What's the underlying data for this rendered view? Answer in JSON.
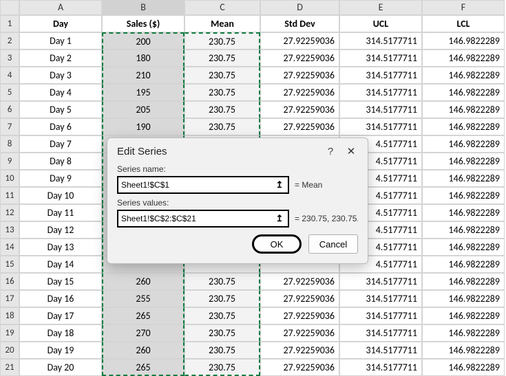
{
  "columns": [
    "A",
    "B",
    "C",
    "D",
    "E",
    "F"
  ],
  "headers": {
    "A": "Day",
    "B": "Sales ($)",
    "C": "Mean",
    "D": "Std Dev",
    "E": "UCL",
    "F": "LCL"
  },
  "rows": [
    {
      "n": 2,
      "day": "Day 1",
      "sales": "200",
      "mean": "230.75",
      "std": "27.92259036",
      "ucl": "314.5177711",
      "lcl": "146.9822289"
    },
    {
      "n": 3,
      "day": "Day 2",
      "sales": "180",
      "mean": "230.75",
      "std": "27.92259036",
      "ucl": "314.5177711",
      "lcl": "146.9822289"
    },
    {
      "n": 4,
      "day": "Day 3",
      "sales": "210",
      "mean": "230.75",
      "std": "27.92259036",
      "ucl": "314.5177711",
      "lcl": "146.9822289"
    },
    {
      "n": 5,
      "day": "Day 4",
      "sales": "195",
      "mean": "230.75",
      "std": "27.92259036",
      "ucl": "314.5177711",
      "lcl": "146.9822289"
    },
    {
      "n": 6,
      "day": "Day 5",
      "sales": "205",
      "mean": "230.75",
      "std": "27.92259036",
      "ucl": "314.5177711",
      "lcl": "146.9822289"
    },
    {
      "n": 7,
      "day": "Day 6",
      "sales": "190",
      "mean": "230.75",
      "std": "27.92259036",
      "ucl": "314.5177711",
      "lcl": "146.9822289"
    },
    {
      "n": 8,
      "day": "Day 7",
      "sales": "",
      "mean": "",
      "std": "",
      "ucl": "4.5177711",
      "lcl": "146.9822289"
    },
    {
      "n": 9,
      "day": "Day 8",
      "sales": "",
      "mean": "",
      "std": "",
      "ucl": "4.5177711",
      "lcl": "146.9822289"
    },
    {
      "n": 10,
      "day": "Day 9",
      "sales": "",
      "mean": "",
      "std": "",
      "ucl": "4.5177711",
      "lcl": "146.9822289"
    },
    {
      "n": 11,
      "day": "Day 10",
      "sales": "",
      "mean": "",
      "std": "",
      "ucl": "4.5177711",
      "lcl": "146.9822289"
    },
    {
      "n": 12,
      "day": "Day 11",
      "sales": "",
      "mean": "",
      "std": "",
      "ucl": "4.5177711",
      "lcl": "146.9822289"
    },
    {
      "n": 13,
      "day": "Day 12",
      "sales": "",
      "mean": "",
      "std": "",
      "ucl": "4.5177711",
      "lcl": "146.9822289"
    },
    {
      "n": 14,
      "day": "Day 13",
      "sales": "",
      "mean": "",
      "std": "",
      "ucl": "4.5177711",
      "lcl": "146.9822289"
    },
    {
      "n": 15,
      "day": "Day 14",
      "sales": "",
      "mean": "",
      "std": "",
      "ucl": "4.5177711",
      "lcl": "146.9822289"
    },
    {
      "n": 16,
      "day": "Day 15",
      "sales": "260",
      "mean": "230.75",
      "std": "27.92259036",
      "ucl": "314.5177711",
      "lcl": "146.9822289"
    },
    {
      "n": 17,
      "day": "Day 16",
      "sales": "255",
      "mean": "230.75",
      "std": "27.92259036",
      "ucl": "314.5177711",
      "lcl": "146.9822289"
    },
    {
      "n": 18,
      "day": "Day 17",
      "sales": "265",
      "mean": "230.75",
      "std": "27.92259036",
      "ucl": "314.5177711",
      "lcl": "146.9822289"
    },
    {
      "n": 19,
      "day": "Day 18",
      "sales": "270",
      "mean": "230.75",
      "std": "27.92259036",
      "ucl": "314.5177711",
      "lcl": "146.9822289"
    },
    {
      "n": 20,
      "day": "Day 19",
      "sales": "260",
      "mean": "230.75",
      "std": "27.92259036",
      "ucl": "314.5177711",
      "lcl": "146.9822289"
    },
    {
      "n": 21,
      "day": "Day 20",
      "sales": "265",
      "mean": "230.75",
      "std": "27.92259036",
      "ucl": "314.5177711",
      "lcl": "146.9822289"
    }
  ],
  "dialog": {
    "title": "Edit Series",
    "help": "?",
    "close": "✕",
    "label_name": "Series name:",
    "input_name": "Sheet1!$C$1",
    "eq_name": "= Mean",
    "label_values": "Series values:",
    "input_values": "Sheet1!$C$2:$C$21",
    "eq_values": "= 230.75, 230.75...",
    "ok": "OK",
    "cancel": "Cancel",
    "picker_glyph": "↥"
  }
}
